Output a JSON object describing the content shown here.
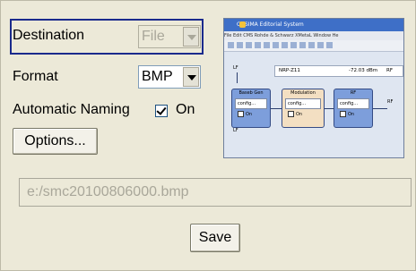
{
  "colors": {
    "background": "#ece9d8",
    "focus_border": "#1a2a8c",
    "disabled_text": "#a9a79a"
  },
  "destination": {
    "label": "Destination",
    "value": "File"
  },
  "format": {
    "label": "Format",
    "value": "BMP"
  },
  "automatic_naming": {
    "label": "Automatic Naming",
    "checked": true,
    "state_label": "On"
  },
  "options_button": {
    "label": "Options..."
  },
  "file_path": {
    "value": "e:/smc20100806000.bmp"
  },
  "save_button": {
    "label": "Save"
  },
  "preview": {
    "title": "COSIMA Editorial System",
    "menu": "File  Edit  CMS  Rohde & Schwarz  XMetaL  Window  He",
    "status_item": "NRP-Z11",
    "status_value": "-72.03 dBm",
    "status_rf": "RF",
    "lf_left": "LF",
    "rf_right": "RF",
    "lf_bottom": "LF",
    "blocks": [
      {
        "title": "Baseb Gen",
        "config": "config...",
        "on": "On"
      },
      {
        "title": "Modulation",
        "config": "config...",
        "on": "On"
      },
      {
        "title": "RF",
        "config": "config...",
        "on": "On"
      }
    ]
  }
}
